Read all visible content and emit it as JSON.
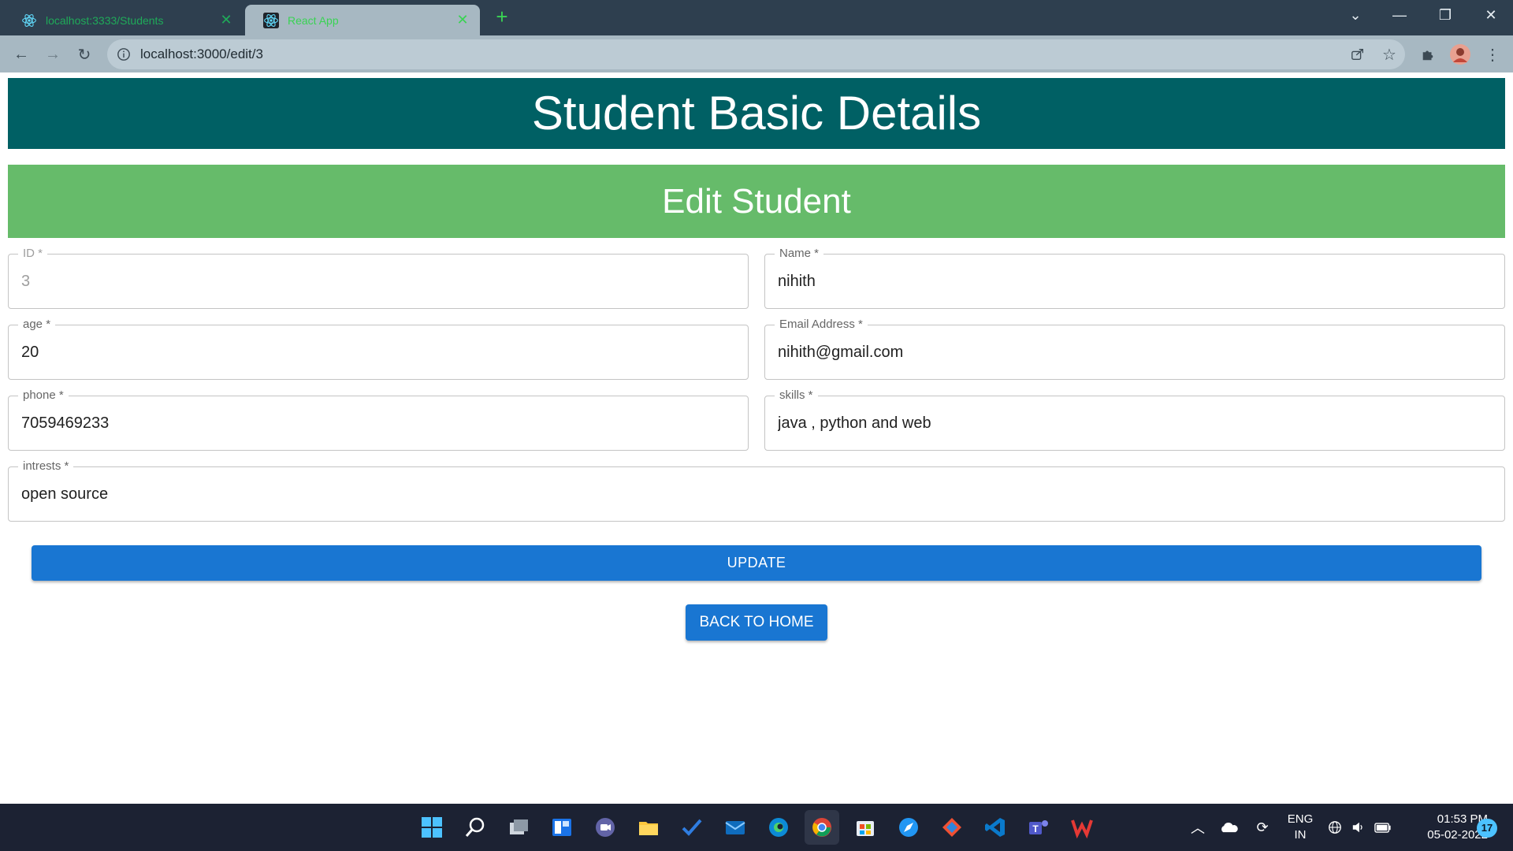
{
  "browser": {
    "tabs": [
      {
        "label": "localhost:3333/Students",
        "icon": "react-logo-icon"
      },
      {
        "label": "React App",
        "icon": "react-logo-icon",
        "active": true
      }
    ],
    "url": "localhost:3000/edit/3"
  },
  "page": {
    "header_title": "Student Basic Details",
    "form_title": "Edit Student",
    "fields": {
      "id": {
        "label": "ID *",
        "value": "3"
      },
      "name": {
        "label": "Name *",
        "value": "nihith"
      },
      "age": {
        "label": "age *",
        "value": "20"
      },
      "email": {
        "label": "Email Address *",
        "value": "nihith@gmail.com"
      },
      "phone": {
        "label": "phone *",
        "value": "7059469233"
      },
      "skills": {
        "label": "skills *",
        "value": "java , python and web"
      },
      "intrests": {
        "label": "intrests *",
        "value": "open source"
      }
    },
    "update_label": "UPDATE",
    "back_label": "BACK TO HOME"
  },
  "taskbar": {
    "language": [
      "ENG",
      "IN"
    ],
    "time": "01:53 PM",
    "date": "05-02-2022",
    "notification_count": "17"
  },
  "colors": {
    "header": "#006064",
    "subheader": "#66bb6a",
    "button": "#1976d2"
  }
}
